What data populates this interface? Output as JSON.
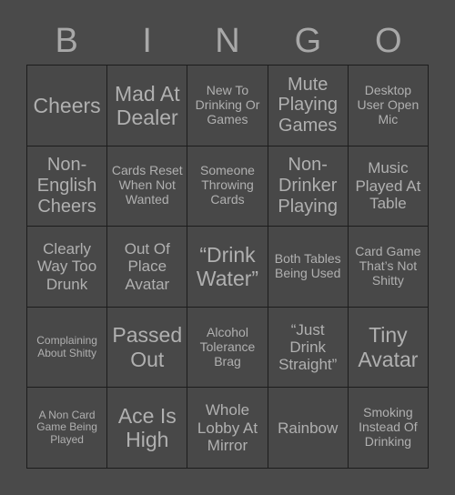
{
  "header": {
    "letters": [
      "B",
      "I",
      "N",
      "G",
      "O"
    ]
  },
  "colors": {
    "page_background": "#4a4a4a",
    "cell_background": "#484848",
    "cell_border": "#1d1d1d",
    "text": "#b0b0b0",
    "header_text": "#a8a8a8"
  },
  "grid": {
    "rows": 5,
    "columns": 5,
    "cells": [
      {
        "text": "Cheers",
        "size": "xl"
      },
      {
        "text": "Mad At Dealer",
        "size": "xl"
      },
      {
        "text": "New To Drinking Or Games",
        "size": "sm"
      },
      {
        "text": "Mute Playing Games",
        "size": "lg"
      },
      {
        "text": "Desktop User Open Mic",
        "size": "sm"
      },
      {
        "text": "Non-English Cheers",
        "size": "lg"
      },
      {
        "text": "Cards Reset When Not Wanted",
        "size": "sm"
      },
      {
        "text": "Someone Throwing Cards",
        "size": "sm"
      },
      {
        "text": "Non-Drinker Playing",
        "size": "lg"
      },
      {
        "text": "Music Played At Table",
        "size": "md"
      },
      {
        "text": "Clearly Way Too Drunk",
        "size": "md"
      },
      {
        "text": "Out Of Place Avatar",
        "size": "md"
      },
      {
        "text": "“Drink Water”",
        "size": "xl"
      },
      {
        "text": "Both Tables Being Used",
        "size": "sm"
      },
      {
        "text": "Card Game That’s Not Shitty",
        "size": "sm"
      },
      {
        "text": "Complaining About Shitty",
        "size": "xs"
      },
      {
        "text": "Passed Out",
        "size": "xl"
      },
      {
        "text": "Alcohol Tolerance Brag",
        "size": "sm"
      },
      {
        "text": "“Just Drink Straight”",
        "size": "md"
      },
      {
        "text": "Tiny Avatar",
        "size": "xl"
      },
      {
        "text": "A Non Card Game Being Played",
        "size": "xs"
      },
      {
        "text": "Ace Is High",
        "size": "xl"
      },
      {
        "text": "Whole Lobby At Mirror",
        "size": "md"
      },
      {
        "text": "Rainbow",
        "size": "md"
      },
      {
        "text": "Smoking Instead Of Drinking",
        "size": "sm"
      }
    ]
  }
}
